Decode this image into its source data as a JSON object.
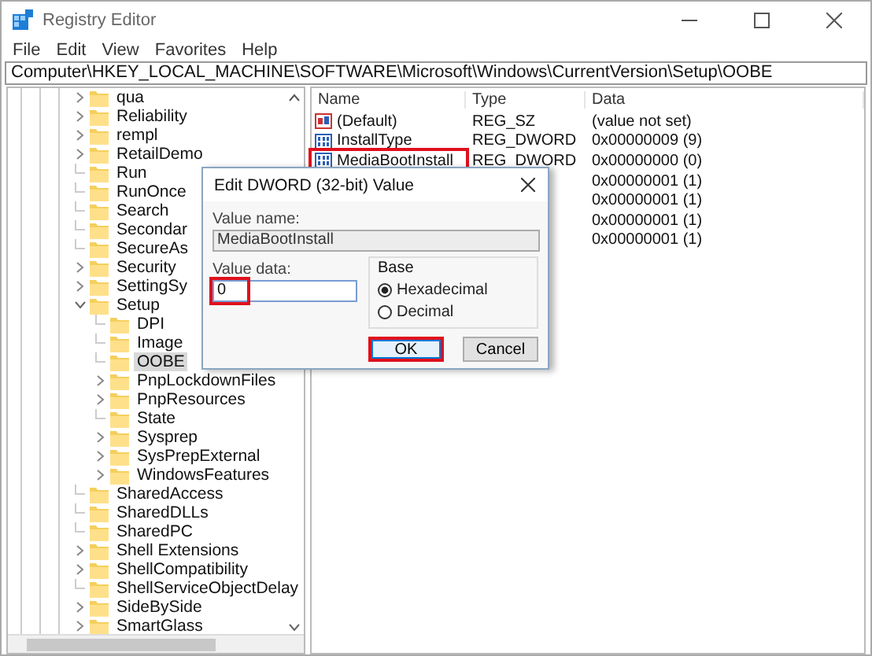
{
  "window": {
    "title": "Registry Editor"
  },
  "menu": [
    "File",
    "Edit",
    "View",
    "Favorites",
    "Help"
  ],
  "address": "Computer\\HKEY_LOCAL_MACHINE\\SOFTWARE\\Microsoft\\Windows\\CurrentVersion\\Setup\\OOBE",
  "tree": {
    "items": [
      {
        "label": "qua",
        "has_children": true,
        "expanded": false,
        "selected": false
      },
      {
        "label": "Reliability",
        "has_children": true,
        "expanded": false,
        "selected": false
      },
      {
        "label": "rempl",
        "has_children": true,
        "expanded": false,
        "selected": false
      },
      {
        "label": "RetailDemo",
        "has_children": true,
        "expanded": false,
        "selected": false
      },
      {
        "label": "Run",
        "has_children": false,
        "expanded": false,
        "selected": false
      },
      {
        "label": "RunOnce",
        "has_children": false,
        "expanded": false,
        "selected": false
      },
      {
        "label": "Search",
        "has_children": false,
        "expanded": false,
        "selected": false
      },
      {
        "label": "Secondar",
        "has_children": false,
        "expanded": false,
        "selected": false
      },
      {
        "label": "SecureAs",
        "has_children": false,
        "expanded": false,
        "selected": false
      },
      {
        "label": "Security",
        "has_children": true,
        "expanded": false,
        "selected": false
      },
      {
        "label": "SettingSy",
        "has_children": true,
        "expanded": false,
        "selected": false
      },
      {
        "label": "Setup",
        "has_children": true,
        "expanded": true,
        "selected": false,
        "children": [
          {
            "label": "DPI",
            "has_children": false,
            "expanded": false,
            "selected": false
          },
          {
            "label": "Image",
            "has_children": false,
            "expanded": false,
            "selected": false
          },
          {
            "label": "OOBE",
            "has_children": false,
            "expanded": false,
            "selected": true
          },
          {
            "label": "PnpLockdownFiles",
            "has_children": true,
            "expanded": false,
            "selected": false
          },
          {
            "label": "PnpResources",
            "has_children": true,
            "expanded": false,
            "selected": false
          },
          {
            "label": "State",
            "has_children": false,
            "expanded": false,
            "selected": false
          },
          {
            "label": "Sysprep",
            "has_children": true,
            "expanded": false,
            "selected": false
          },
          {
            "label": "SysPrepExternal",
            "has_children": true,
            "expanded": false,
            "selected": false
          },
          {
            "label": "WindowsFeatures",
            "has_children": true,
            "expanded": false,
            "selected": false
          }
        ]
      },
      {
        "label": "SharedAccess",
        "has_children": false,
        "expanded": false,
        "selected": false
      },
      {
        "label": "SharedDLLs",
        "has_children": false,
        "expanded": false,
        "selected": false
      },
      {
        "label": "SharedPC",
        "has_children": false,
        "expanded": false,
        "selected": false
      },
      {
        "label": "Shell Extensions",
        "has_children": true,
        "expanded": false,
        "selected": false
      },
      {
        "label": "ShellCompatibility",
        "has_children": true,
        "expanded": false,
        "selected": false
      },
      {
        "label": "ShellServiceObjectDelay",
        "has_children": false,
        "expanded": false,
        "selected": false
      },
      {
        "label": "SideBySide",
        "has_children": true,
        "expanded": false,
        "selected": false
      },
      {
        "label": "SmartGlass",
        "has_children": true,
        "expanded": false,
        "selected": false
      }
    ]
  },
  "values": {
    "columns": [
      "Name",
      "Type",
      "Data"
    ],
    "rows": [
      {
        "kind": "string",
        "name": "(Default)",
        "type": "REG_SZ",
        "data": "(value not set)",
        "highlighted": false
      },
      {
        "kind": "dword",
        "name": "InstallType",
        "type": "REG_DWORD",
        "data": "0x00000009 (9)",
        "highlighted": false
      },
      {
        "kind": "dword",
        "name": "MediaBootInstall",
        "type": "REG_DWORD",
        "data": "0x00000000 (0)",
        "highlighted": true
      },
      {
        "data": "0x00000001 (1)",
        "highlighted": false
      },
      {
        "data": "0x00000001 (1)",
        "highlighted": false
      },
      {
        "data": "0x00000001 (1)",
        "highlighted": false
      },
      {
        "data": "0x00000001 (1)",
        "highlighted": false
      }
    ]
  },
  "dialog": {
    "title": "Edit DWORD (32-bit) Value",
    "value_name_label": "Value name:",
    "value_name": "MediaBootInstall",
    "value_data_label": "Value data:",
    "value_data": "0",
    "value_data_highlighted": true,
    "base_label": "Base",
    "base_options": [
      {
        "label": "Hexadecimal",
        "selected": true
      },
      {
        "label": "Decimal",
        "selected": false
      }
    ],
    "buttons": [
      {
        "label": "OK",
        "default": true,
        "highlighted": true
      },
      {
        "label": "Cancel",
        "default": false,
        "highlighted": false
      }
    ]
  }
}
